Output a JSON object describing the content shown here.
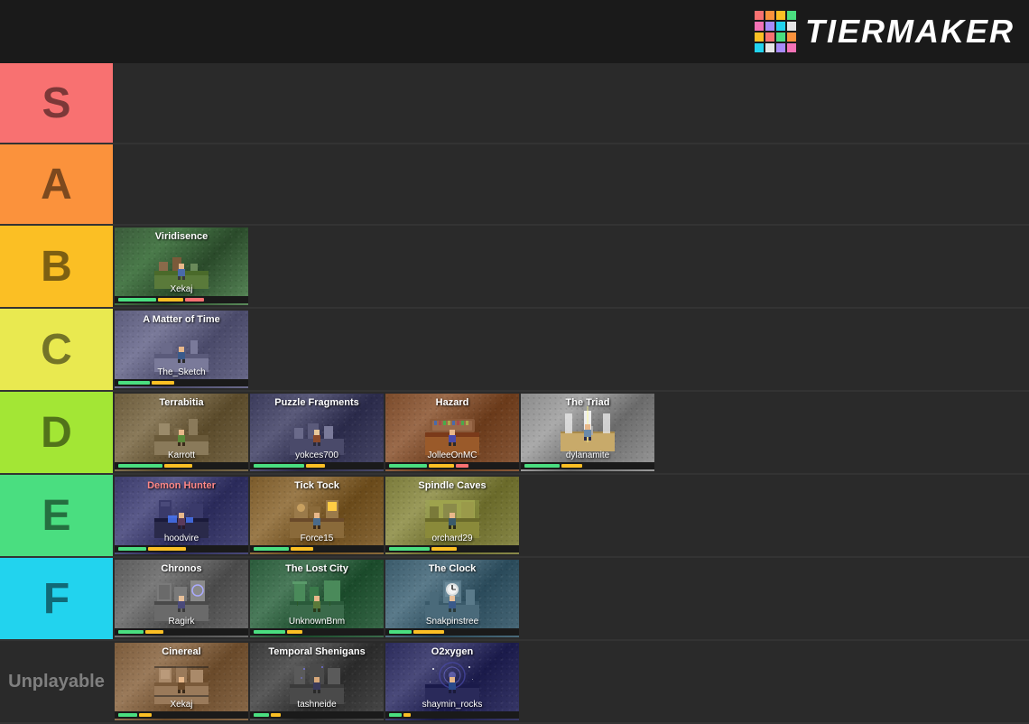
{
  "header": {
    "logo_text": "TiERMAKER",
    "logo_colors": [
      "#f87171",
      "#fb923c",
      "#fbbf24",
      "#4ade80",
      "#22d3ee",
      "#a78bfa",
      "#f472b6",
      "#e5e5e5"
    ]
  },
  "tiers": [
    {
      "id": "s",
      "label": "S",
      "color": "#f87171",
      "cards": []
    },
    {
      "id": "a",
      "label": "A",
      "color": "#fb923c",
      "cards": []
    },
    {
      "id": "b",
      "label": "B",
      "color": "#fbbf24",
      "cards": [
        {
          "title": "Viridisence",
          "author": "Xekaj",
          "bg": "viridisence"
        }
      ]
    },
    {
      "id": "c",
      "label": "C",
      "color": "#e9e950",
      "cards": [
        {
          "title": "A Matter of Time",
          "author": "The_Sketch",
          "bg": "matter"
        }
      ]
    },
    {
      "id": "d",
      "label": "D",
      "color": "#a3e635",
      "cards": [
        {
          "title": "Terrabitia",
          "author": "Karrott",
          "bg": "terrabitia"
        },
        {
          "title": "Puzzle Fragments",
          "author": "yokces700",
          "bg": "puzzle"
        },
        {
          "title": "Hazard",
          "author": "JolleeOnMC",
          "bg": "hazard"
        },
        {
          "title": "The Triad",
          "author": "dylanamite",
          "bg": "triad"
        }
      ]
    },
    {
      "id": "e",
      "label": "E",
      "color": "#4ade80",
      "cards": [
        {
          "title": "Demon Hunter",
          "author": "hoodvire",
          "bg": "demonhunter"
        },
        {
          "title": "Tick Tock",
          "author": "Force15",
          "bg": "ticktock"
        },
        {
          "title": "Spindle Caves",
          "author": "orchard29",
          "bg": "spindle"
        }
      ]
    },
    {
      "id": "f",
      "label": "F",
      "color": "#22d3ee",
      "cards": [
        {
          "title": "Chronos",
          "author": "Ragirk",
          "bg": "chronos"
        },
        {
          "title": "The Lost City",
          "author": "UnknownBnm",
          "bg": "lostcity"
        },
        {
          "title": "The Clock",
          "author": "Snakpinstree",
          "bg": "clock"
        }
      ]
    },
    {
      "id": "unplayable",
      "label": "Unplayable",
      "color": "#2a2a2a",
      "cards": [
        {
          "title": "Cinereal",
          "author": "Xekaj",
          "bg": "cinereal"
        },
        {
          "title": "Temporal Shenigans",
          "author": "tashneide",
          "bg": "temporal"
        },
        {
          "title": "O2xygen",
          "author": "shaymin_rocks",
          "bg": "o2xygen"
        }
      ]
    }
  ]
}
